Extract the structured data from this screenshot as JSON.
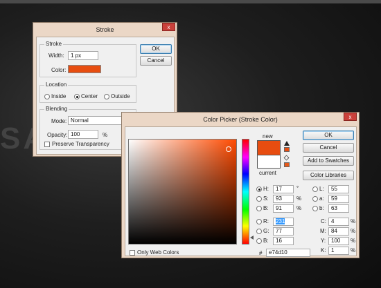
{
  "background_text": "SA",
  "stroke": {
    "title": "Stroke",
    "close_label": "x",
    "group_stroke": "Stroke",
    "width_label": "Width:",
    "width_value": "1 px",
    "color_label": "Color:",
    "color_swatch": "#e74d10",
    "group_location": "Location",
    "loc_inside": "Inside",
    "loc_center": "Center",
    "loc_outside": "Outside",
    "group_blending": "Blending",
    "mode_label": "Mode:",
    "mode_value": "Normal",
    "opacity_label": "Opacity:",
    "opacity_value": "100",
    "opacity_unit": "%",
    "preserve_label": "Preserve Transparency",
    "ok_label": "OK",
    "cancel_label": "Cancel"
  },
  "picker": {
    "title": "Color Picker (Stroke Color)",
    "close_label": "x",
    "new_label": "new",
    "current_label": "current",
    "new_color": "#e74d10",
    "current_color": "#ffffff",
    "hue_color": "#ff4a00",
    "ok_label": "OK",
    "cancel_label": "Cancel",
    "swatches_label": "Add to Swatches",
    "libraries_label": "Color Libraries",
    "web_only_label": "Only Web Colors",
    "hsb": [
      {
        "label": "H:",
        "value": "17",
        "unit": "°"
      },
      {
        "label": "S:",
        "value": "93",
        "unit": "%"
      },
      {
        "label": "B:",
        "value": "91",
        "unit": "%"
      }
    ],
    "rgb": [
      {
        "label": "R:",
        "value": "231",
        "unit": ""
      },
      {
        "label": "G:",
        "value": "77",
        "unit": ""
      },
      {
        "label": "B:",
        "value": "16",
        "unit": ""
      }
    ],
    "lab": [
      {
        "label": "L:",
        "value": "55"
      },
      {
        "label": "a:",
        "value": "59"
      },
      {
        "label": "b:",
        "value": "63"
      }
    ],
    "cmyk": [
      {
        "label": "C:",
        "value": "4",
        "unit": "%"
      },
      {
        "label": "M:",
        "value": "84",
        "unit": "%"
      },
      {
        "label": "Y:",
        "value": "100",
        "unit": "%"
      },
      {
        "label": "K:",
        "value": "1",
        "unit": "%"
      }
    ],
    "hex_label": "#",
    "hex_value": "e74d10"
  }
}
